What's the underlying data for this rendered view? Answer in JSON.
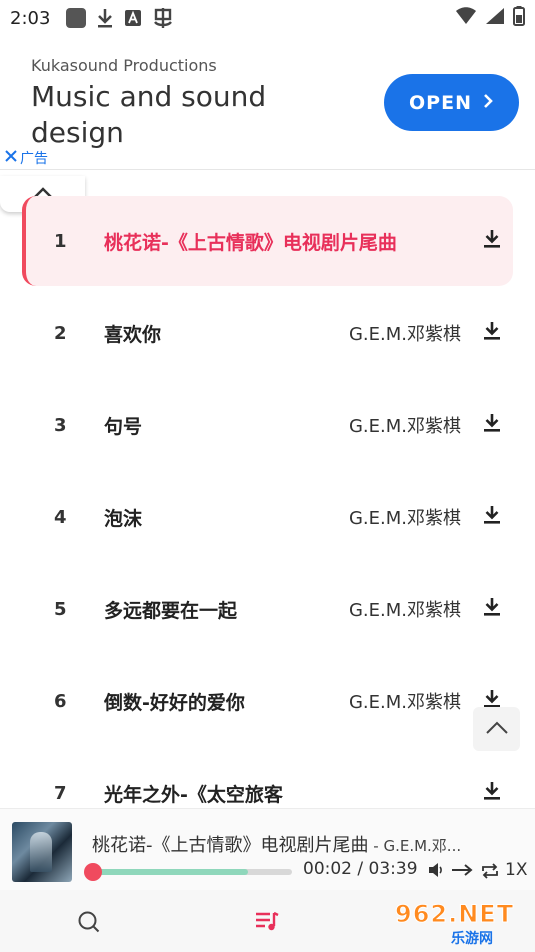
{
  "status_bar": {
    "time": "2:03"
  },
  "ad": {
    "sponsor": "Kukasound Productions",
    "title": "Music and sound design",
    "open_label": "OPEN",
    "ad_label": "广告",
    "accent_color": "#1a73e8"
  },
  "songs": [
    {
      "num": "1",
      "title": "桃花诺-《上古情歌》电视剧片尾曲",
      "artist": "",
      "active": true
    },
    {
      "num": "2",
      "title": "喜欢你",
      "artist": "G.E.M.邓紫棋"
    },
    {
      "num": "3",
      "title": "句号",
      "artist": "G.E.M.邓紫棋"
    },
    {
      "num": "4",
      "title": "泡沫",
      "artist": "G.E.M.邓紫棋"
    },
    {
      "num": "5",
      "title": "多远都要在一起",
      "artist": "G.E.M.邓紫棋"
    },
    {
      "num": "6",
      "title": "倒数-好好的爱你",
      "artist": "G.E.M.邓紫棋"
    },
    {
      "num": "7",
      "title": "光年之外-《太空旅客",
      "artist": ""
    }
  ],
  "player": {
    "title": "桃花诺-《上古情歌》电视剧片尾曲",
    "artist_suffix": " - G.E.M.邓...",
    "current_time": "00:02",
    "separator": " / ",
    "total_time": "03:39",
    "progress_fraction": 0.01,
    "buffer_fraction": 0.78,
    "speed": "1X",
    "accent_color": "#f04a5e"
  },
  "watermark": {
    "main": "962.NET",
    "sub": "乐游网"
  }
}
